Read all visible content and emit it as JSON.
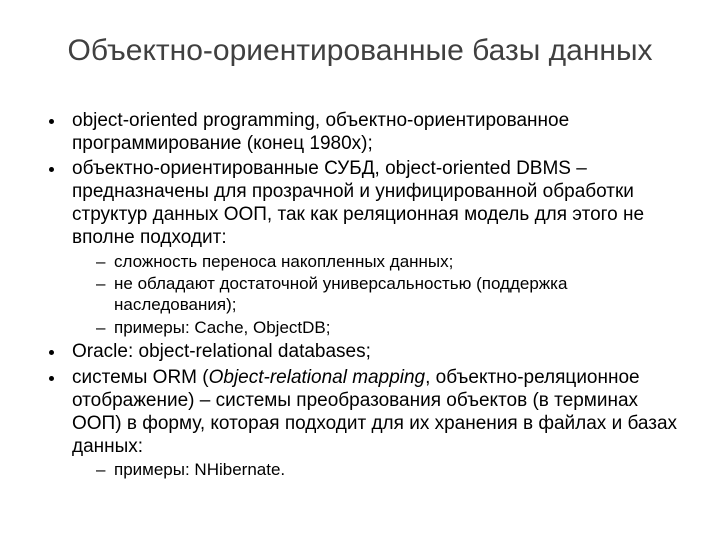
{
  "title": "Объектно-ориентированные базы данных",
  "bullets": {
    "b1": "object-oriented programming, объектно-ориентированное программирование (конец 1980х);",
    "b2": "объектно-ориентированные СУБД, object-oriented DBMS – предназначены для прозрачной и унифицированной обработки структур данных ООП, так как реляционная модель для этого не вполне подходит:",
    "b2_sub": {
      "s1": "сложность переноса накопленных данных;",
      "s2": "не обладают достаточной универсальностью (поддержка наследования);",
      "s3": "примеры: Cache, ObjectDB;"
    },
    "b3": "Oracle: object-relational databases;",
    "b4_prefix": "системы ORM (",
    "b4_em": "Object-relational mapping",
    "b4_suffix": ", объектно-реляционное отображение) – системы преобразования объектов (в терминах ООП) в форму, которая подходит для их хранения в файлах и базах данных:",
    "b4_sub": {
      "s1": "примеры: NHibernate."
    }
  }
}
